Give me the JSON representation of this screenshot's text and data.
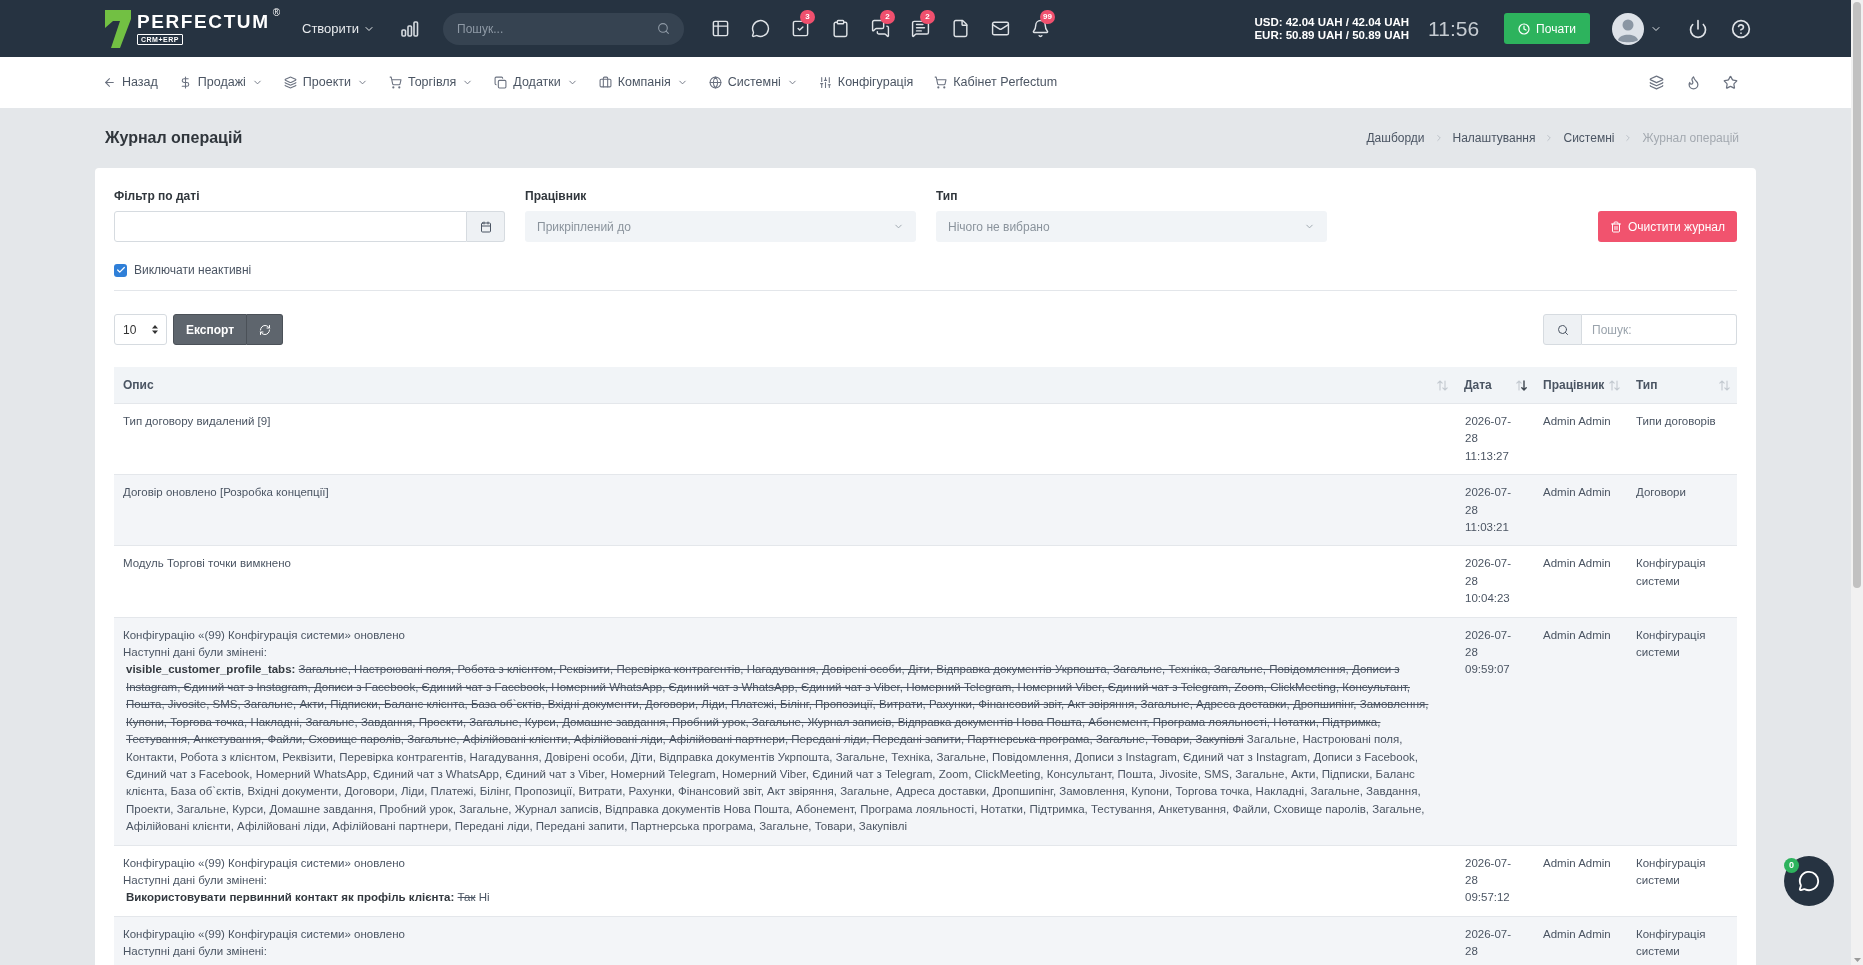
{
  "top_bar": {
    "logo": {
      "wordmark": "PERFECTUM",
      "mark": "®",
      "tagline": "CRM+ERP"
    },
    "create_menu": "Створити",
    "search": {
      "placeholder": "Пошук..."
    },
    "toolbar": [
      {
        "kind": "table"
      },
      {
        "kind": "chat"
      },
      {
        "kind": "tasks",
        "badge": "3"
      },
      {
        "kind": "clipboard"
      },
      {
        "kind": "comments",
        "badge": "2"
      },
      {
        "kind": "messages",
        "badge": "2"
      },
      {
        "kind": "file"
      },
      {
        "kind": "mail"
      },
      {
        "kind": "bell",
        "badge": "99"
      }
    ],
    "currency": [
      "USD: 42.04 UAH / 42.04 UAH",
      "EUR: 50.89 UAH / 50.89 UAH"
    ],
    "time": "11:56",
    "start_button": "Почати"
  },
  "nav": {
    "items": [
      {
        "kind": "back",
        "label": "Назад",
        "dropdown": false
      },
      {
        "kind": "sales",
        "label": "Продажі",
        "dropdown": true
      },
      {
        "kind": "projects",
        "label": "Проекти",
        "dropdown": true
      },
      {
        "kind": "trade",
        "label": "Торгівля",
        "dropdown": true
      },
      {
        "kind": "addons",
        "label": "Додатки",
        "dropdown": true
      },
      {
        "kind": "company",
        "label": "Компанія",
        "dropdown": true
      },
      {
        "kind": "system",
        "label": "Системні",
        "dropdown": true
      },
      {
        "kind": "config",
        "label": "Конфігурація",
        "dropdown": false
      },
      {
        "kind": "cabinet",
        "label": "Кабінет Perfectum",
        "dropdown": false
      }
    ]
  },
  "page": {
    "title": "Журнал операцій",
    "breadcrumbs": [
      {
        "label": "Дашборди",
        "current": false
      },
      {
        "label": "Налаштування",
        "current": false
      },
      {
        "label": "Системні",
        "current": false
      },
      {
        "label": "Журнал операцій",
        "current": true
      }
    ]
  },
  "filters": {
    "date": {
      "label": "Фільтр по даті"
    },
    "employee": {
      "label": "Працівник",
      "placeholder": "Прикріплений до"
    },
    "type": {
      "label": "Тип",
      "placeholder": "Нічого не вибрано"
    },
    "clear_button": "Очистити журнал",
    "exclude_inactive": {
      "label": "Виключати неактивні",
      "checked": true
    }
  },
  "table_controls": {
    "page_length": "10",
    "export_button": "Експорт",
    "search": {
      "placeholder": "Пошук:"
    }
  },
  "table": {
    "columns": [
      {
        "label": "Опис",
        "sorted": false
      },
      {
        "label": "Дата",
        "sorted": true
      },
      {
        "label": "Працівник",
        "sorted": false
      },
      {
        "label": "Тип",
        "sorted": false
      }
    ],
    "rows": [
      {
        "description": {
          "title": "Тип договору видалений [9]"
        },
        "date": "2026-07-28 11:13:27",
        "employee": "Admin Admin",
        "type": "Типи договорів"
      },
      {
        "description": {
          "title": "Договір оновлено [Розробка концепції]"
        },
        "date": "2026-07-28 11:03:21",
        "employee": "Admin Admin",
        "type": "Договори"
      },
      {
        "description": {
          "title": "Модуль Торгові точки вимкнено"
        },
        "date": "2026-07-28 10:04:23",
        "employee": "Admin Admin",
        "type": "Конфігурація системи"
      },
      {
        "description": {
          "title": "Конфігурацію «(99) Конфігурація системи» оновлено",
          "subtitle": "Наступні дані були змінені:",
          "changes": [
            {
              "field": "visible_customer_profile_tabs:",
              "old": "Загальне, Настроювані поля, Робота з клієнтом, Реквізити, Перевірка контрагентів, Нагадування, Довірені особи, Діти, Відправка документів Укрпошта, Загальне, Техніка, Загальне, Повідомлення, Дописи з Instagram, Єдиний чат з Instagram, Дописи з Facebook, Єдиний чат з Facebook, Номерний WhatsApp, Єдиний чат з WhatsApp, Єдиний чат з Viber, Номерний Telegram, Номерний Viber, Єдиний чат з Telegram, Zoom, ClickMeeting, Консультант, Пошта, Jivosite, SMS, Загальне, Акти, Підписки, Баланс клієнта, База об`єктів, Вхідні документи, Договори, Ліди, Платежі, Білінг, Пропозиції, Витрати, Рахунки, Фінансовий звіт, Акт звіряння, Загальне, Адреса доставки, Дропшипінг, Замовлення, Купони, Торгова точка, Накладні, Загальне, Завдання, Проекти, Загальне, Курси, Домашне завдання, Пробний урок, Загальне, Журнал записів, Відправка документів Нова Пошта, Абонемент, Програма лояльності, Нотатки, Підтримка, Тестування, Анкетування, Файли, Сховище паролів, Загальне, Афілійовані клієнти, Афілійовані ліди, Афілійовані партнери, Передані ліди, Передані запити, Партнерська програма, Загальне, Товари, Закупівлі",
              "new": "Загальне, Настроювані поля, Контакти, Робота з клієнтом, Реквізити, Перевірка контрагентів, Нагадування, Довірені особи, Діти, Відправка документів Укрпошта, Загальне, Техніка, Загальне, Повідомлення, Дописи з Instagram, Єдиний чат з Instagram, Дописи з Facebook, Єдиний чат з Facebook, Номерний WhatsApp, Єдиний чат з WhatsApp, Єдиний чат з Viber, Номерний Telegram, Номерний Viber, Єдиний чат з Telegram, Zoom, ClickMeeting, Консультант, Пошта, Jivosite, SMS, Загальне, Акти, Підписки, Баланс клієнта, База об`єктів, Вхідні документи, Договори, Ліди, Платежі, Білінг, Пропозиції, Витрати, Рахунки, Фінансовий звіт, Акт звіряння, Загальне, Адреса доставки, Дропшипінг, Замовлення, Купони, Торгова точка, Накладні, Загальне, Завдання, Проекти, Загальне, Курси, Домашне завдання, Пробний урок, Загальне, Журнал записів, Відправка документів Нова Пошта, Абонемент, Програма лояльності, Нотатки, Підтримка, Тестування, Анкетування, Файли, Сховище паролів, Загальне, Афілійовані клієнти, Афілійовані ліди, Афілійовані партнери, Передані ліди, Передані запити, Партнерська програма, Загальне, Товари, Закупівлі"
            }
          ]
        },
        "date": "2026-07-28 09:59:07",
        "employee": "Admin Admin",
        "type": "Конфігурація системи"
      },
      {
        "description": {
          "title": "Конфігурацію «(99) Конфігурація системи» оновлено",
          "subtitle": "Наступні дані були змінені:",
          "changes": [
            {
              "field": "Використовувати первинний контакт як профіль клієнта:",
              "old": "Так",
              "new": "Ні"
            }
          ]
        },
        "date": "2026-07-28 09:57:12",
        "employee": "Admin Admin",
        "type": "Конфігурація системи"
      },
      {
        "description": {
          "title": "Конфігурацію «(99) Конфігурація системи» оновлено",
          "subtitle": "Наступні дані були змінені:"
        },
        "date": "2026-07-28",
        "employee": "Admin Admin",
        "type": "Конфігурація системи"
      }
    ]
  },
  "chat_widget": {
    "badge": "0"
  }
}
